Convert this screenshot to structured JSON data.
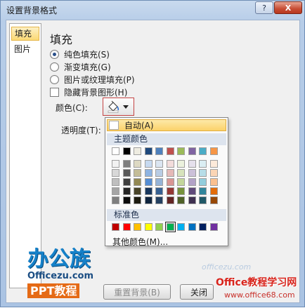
{
  "window": {
    "title": "设置背景格式",
    "help_label": "?",
    "close_label": "X"
  },
  "nav": {
    "items": [
      {
        "label": "填充",
        "active": true
      },
      {
        "label": "图片",
        "active": false
      }
    ]
  },
  "fill": {
    "section_title": "填充",
    "options": [
      {
        "label": "纯色填充(S)",
        "type": "radio",
        "checked": true
      },
      {
        "label": "渐变填充(G)",
        "type": "radio",
        "checked": false
      },
      {
        "label": "图片或纹理填充(P)",
        "type": "radio",
        "checked": false
      },
      {
        "label": "隐藏背景图形(H)",
        "type": "checkbox",
        "checked": false
      }
    ],
    "color_label": "颜色(C):",
    "transparency_label": "透明度(T):"
  },
  "palette": {
    "auto_label": "自动(A)",
    "theme_header": "主题颜色",
    "standard_header": "标准色",
    "more_colors_label": "其他颜色(M)...",
    "theme_top_row": [
      "#ffffff",
      "#000000",
      "#eeece1",
      "#1f497d",
      "#4f81bd",
      "#c0504d",
      "#9bbb59",
      "#8064a2",
      "#4bacc6",
      "#f79646"
    ],
    "theme_shades": [
      [
        "#f2f2f2",
        "#7f7f7f",
        "#ddd9c3",
        "#c6d9f0",
        "#dbe5f1",
        "#f2dcdb",
        "#ebf1dd",
        "#e5e0ec",
        "#dbeef3",
        "#fdeada"
      ],
      [
        "#d8d8d8",
        "#595959",
        "#c4bd97",
        "#8db3e2",
        "#b8cce4",
        "#e5b9b7",
        "#d7e3bc",
        "#ccc1d9",
        "#b7dde8",
        "#fbd5b5"
      ],
      [
        "#bfbfbf",
        "#3f3f3f",
        "#938953",
        "#548dd4",
        "#95b3d7",
        "#d99694",
        "#c3d69b",
        "#b2a2c7",
        "#92cddc",
        "#fac08f"
      ],
      [
        "#a5a5a5",
        "#262626",
        "#494429",
        "#17365d",
        "#366092",
        "#953734",
        "#76923c",
        "#5f497a",
        "#31859b",
        "#e36c09"
      ],
      [
        "#7f7f7f",
        "#0c0c0c",
        "#1d1b10",
        "#0f243e",
        "#244061",
        "#632423",
        "#4f6128",
        "#3f3151",
        "#205867",
        "#974806"
      ]
    ],
    "standard_colors": [
      "#c00000",
      "#ff0000",
      "#ffc000",
      "#ffff00",
      "#92d050",
      "#00b050",
      "#00b0f0",
      "#0070c0",
      "#002060",
      "#7030a0"
    ],
    "selected_standard_index": 5
  },
  "buttons": {
    "reset_label": "重置背景(B)",
    "close_label": "关闭"
  },
  "watermarks": {
    "logo_main": "办公族",
    "logo_domain": "Officezu.com",
    "logo_tag": "PPT教程",
    "faint_text": "officezu.com",
    "brand": "Office教程学习网",
    "url": "www.office68.com"
  }
}
